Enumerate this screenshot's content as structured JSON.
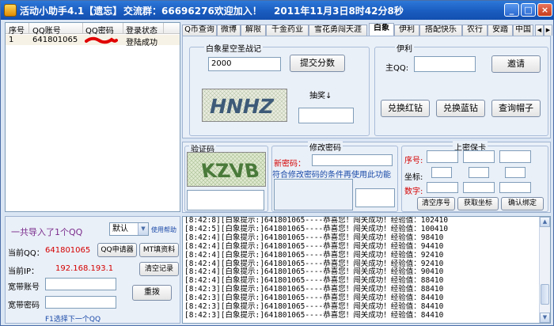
{
  "window": {
    "title": "活动小助手4.1【遗忘】",
    "group": "交流群：66696276欢迎加入！",
    "datetime": "2011年11月3日8时42分8秒",
    "controls": {
      "minimize": "_",
      "maximize": "□",
      "close": "×"
    }
  },
  "accounts": {
    "columns": [
      "序号",
      "QQ账号",
      "QQ密码",
      "登录状态"
    ],
    "rows": [
      {
        "index": "1",
        "qq": "641801065",
        "password": "",
        "status": "登陆成功"
      }
    ]
  },
  "import": {
    "summary": "一共导入了1个QQ",
    "mode_selected": "默认",
    "help_link": "使用帮助"
  },
  "current": {
    "qq_label": "当前QQ：",
    "qq_value": "641801065",
    "ip_label": "当前IP：",
    "ip_value": "192.168.193.1",
    "broadband_account_label": "宽带账号",
    "broadband_account_value": "",
    "broadband_password_label": "宽带密码",
    "broadband_password_value": "",
    "hint": "F1选择下一个QQ"
  },
  "buttons": {
    "qq_apply": "QQ申请器",
    "mt_fill": "MT填资料",
    "clear_log": "清空记录",
    "redial": "重拨"
  },
  "tabs": [
    "Q币查询",
    "微博",
    "解限",
    "千金药业",
    "雪花勇闯天涯",
    "白象",
    "伊利",
    "搭配快乐",
    "农行",
    "安踏",
    "中国"
  ],
  "active_tab": "白象",
  "baixiang": {
    "group_title": "白象星空圣战记",
    "score_value": "2000",
    "submit_label": "提交分数",
    "lottery_label": "抽奖↓",
    "lottery_value": ""
  },
  "yili": {
    "group_title": "伊利",
    "qq_label": "主QQ:",
    "qq_value": "",
    "invite_label": "邀请",
    "exchange_red": "兑换红钻",
    "exchange_blue": "兑换蓝钻",
    "query_hat": "查询帽子"
  },
  "verify": {
    "group_title": "验证码",
    "input_value": ""
  },
  "password": {
    "group_title": "修改密码",
    "new_label": "新密码：",
    "new_value": "",
    "note": "符合修改密码的条件再使用此功能"
  },
  "mibao": {
    "group_title": "上密保卡",
    "seq_label": "序号:",
    "coord_label": "坐标:",
    "digit_label": "数字:",
    "clear_seq": "清空序号",
    "get_coord": "获取坐标",
    "confirm_bind": "确认绑定"
  },
  "log": {
    "lines": [
      "[8:42:8][白象提示:]641801065----恭喜您！闯关成功！经验值：102410",
      "[8:42:5][白象提示:]641801065----恭喜您！闯关成功！经验值：100410",
      "[8:42:4][白象提示:]641801065----恭喜您！闯关成功！经验值：98410",
      "[8:42:4][白象提示:]641801065----恭喜您！闯关成功！经验值：94410",
      "[8:42:4][白象提示:]641801065----恭喜您！闯关成功！经验值：92410",
      "[8:42:4][白象提示:]641801065----恭喜您！闯关成功！经验值：92410",
      "[8:42:4][白象提示:]641801065----恭喜您！闯关成功！经验值：90410",
      "[8:42:4][白象提示:]641801065----恭喜您！闯关成功！经验值：88410",
      "[8:42:3][白象提示:]641801065----恭喜您！闯关成功！经验值：88410",
      "[8:42:3][白象提示:]641801065----恭喜您！闯关成功！经验值：84410",
      "[8:42:3][白象提示:]641801065----恭喜您！闯关成功！经验值：84410",
      "[8:42:3][白象提示:]641801065----恭喜您！闯关成功！经验值：84410"
    ]
  },
  "captcha_text": {
    "top": "HNHZ",
    "verify": "KZVB"
  },
  "colors": {
    "titlebar": "#1a5cc0",
    "accent_red": "#d40000",
    "accent_purple": "#7a2c8c",
    "panel": "#eaf0f8"
  }
}
